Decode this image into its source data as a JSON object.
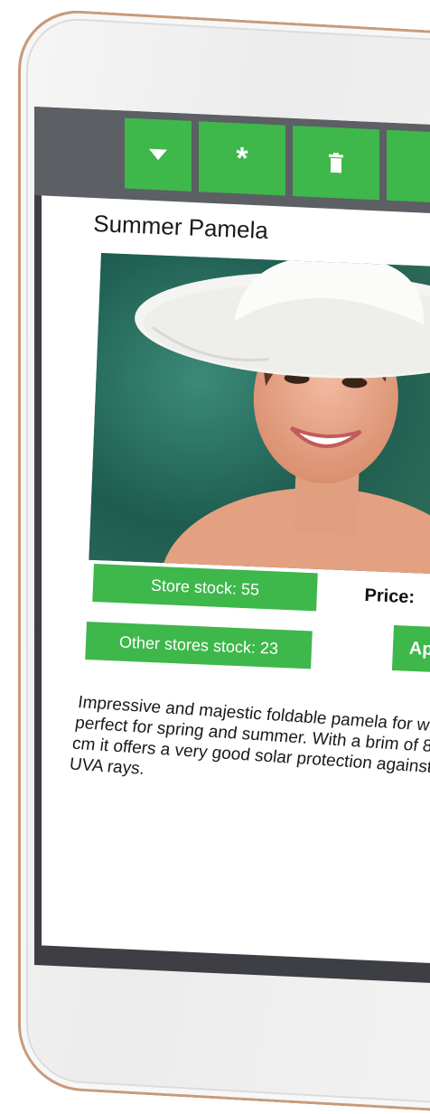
{
  "toolbar": {
    "buttons": [
      {
        "icon": "triangle-down-icon"
      },
      {
        "icon": "asterisk-icon",
        "glyph": "*"
      },
      {
        "icon": "trash-icon"
      },
      {
        "icon": "unknown"
      }
    ]
  },
  "product": {
    "title": "Summer Pamela",
    "store_stock": "Store stock: 55",
    "other_stock": "Other stores stock: 23",
    "price_label": "Price:",
    "action_button_partial": "Ap",
    "description": "Impressive and majestic foldable pamela for women perfect for spring and summer. With a brim of 8.5 cm it offers a very good solar protection against UVA rays."
  },
  "colors": {
    "accent": "#3eb74b",
    "toolbar": "#5c5f64",
    "frame": "#c89a7a"
  }
}
